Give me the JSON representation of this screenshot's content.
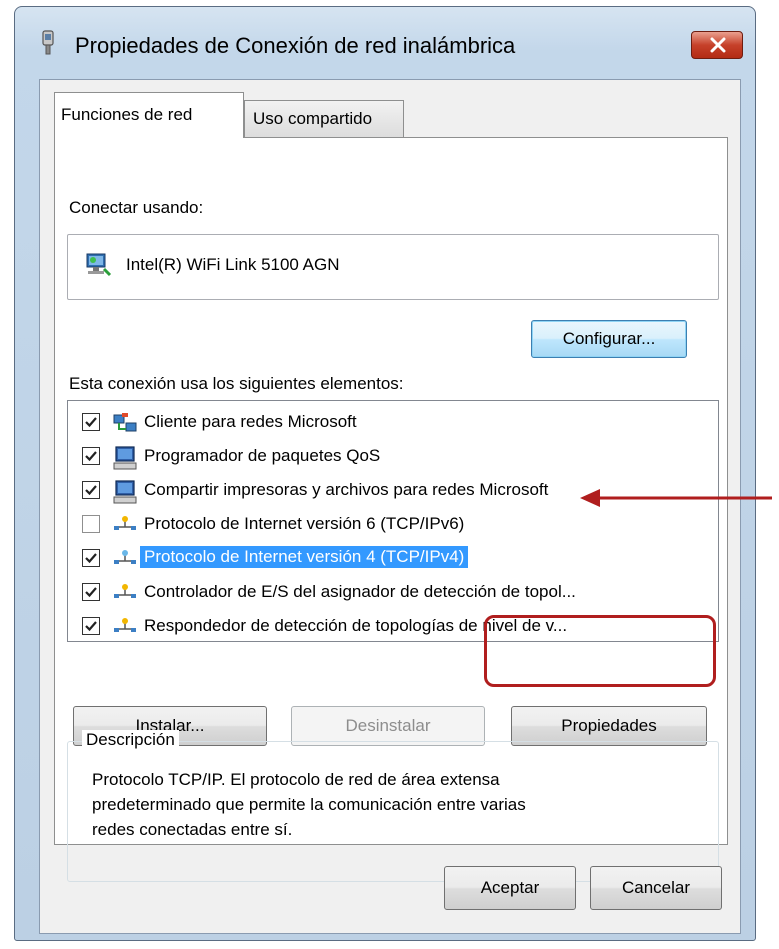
{
  "window": {
    "title": "Propiedades de Conexión de red inalámbrica"
  },
  "tabs": [
    {
      "label": "Funciones de red",
      "active": true
    },
    {
      "label": "Uso compartido",
      "active": false
    }
  ],
  "connect_using": {
    "label": "Conectar usando:",
    "adapter": "Intel(R) WiFi Link 5100 AGN"
  },
  "buttons": {
    "configure": "Configurar...",
    "install": "Instalar...",
    "uninstall": "Desinstalar",
    "properties": "Propiedades",
    "ok": "Aceptar",
    "cancel": "Cancelar"
  },
  "items_label": "Esta conexión usa los siguientes elementos:",
  "items": [
    {
      "label": "Cliente para redes Microsoft",
      "checked": true,
      "icon": "network-client-icon"
    },
    {
      "label": "Programador de paquetes QoS",
      "checked": true,
      "icon": "computer-icon"
    },
    {
      "label": "Compartir impresoras y archivos para redes Microsoft",
      "checked": true,
      "icon": "computer-icon"
    },
    {
      "label": "Protocolo de Internet versión 6 (TCP/IPv6)",
      "checked": false,
      "icon": "protocol-icon"
    },
    {
      "label": "Protocolo de Internet versión 4 (TCP/IPv4)",
      "checked": true,
      "icon": "protocol-icon",
      "selected": true
    },
    {
      "label": "Controlador de E/S del asignador de detección de topol...",
      "checked": true,
      "icon": "protocol-icon"
    },
    {
      "label": "Respondedor de detección de topologías de nivel de v...",
      "checked": true,
      "icon": "protocol-icon"
    }
  ],
  "description": {
    "legend": "Descripción",
    "lines": [
      "Protocolo TCP/IP. El protocolo de red de área extensa",
      "predeterminado que permite la comunicación entre varias",
      "redes conectadas entre sí."
    ]
  },
  "colors": {
    "selection": "#3399ff",
    "annotation": "#b01e1e"
  }
}
